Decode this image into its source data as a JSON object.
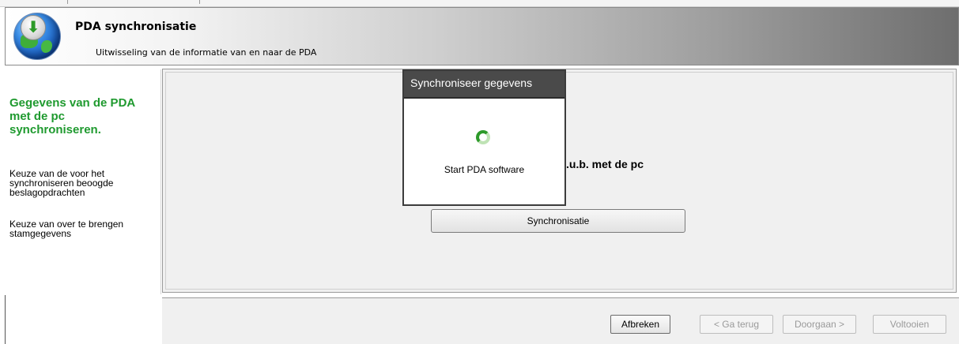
{
  "header": {
    "title": "PDA synchronisatie",
    "subtitle": "Uitwisseling van de informatie van en naar de PDA"
  },
  "sidebar": {
    "title": "Gegevens van de PDA\n met de pc\nsynchroniseren.",
    "items": [
      {
        "label": "Keuze van de voor het\nsynchroniseren beoogde\nbeslagopdrachten"
      },
      {
        "label": "Keuze van over te brengen\nstamgegevens"
      }
    ]
  },
  "main": {
    "instruction_partial": ".u.b. met de pc",
    "sync_button_label": "Synchronisatie"
  },
  "dialog": {
    "title": "Synchroniseer gegevens",
    "status_text": "Start PDA software"
  },
  "footer": {
    "buttons": [
      {
        "label": "Afbreken",
        "enabled": true
      },
      {
        "label": "< Ga terug",
        "enabled": false
      },
      {
        "label": "Doorgaan >",
        "enabled": false
      },
      {
        "label": "Voltooien",
        "enabled": false
      }
    ]
  },
  "colors": {
    "sidebar_title": "#1f9a2f",
    "dialog_title_bg": "#4a4a4a",
    "spinner": "#2d9a2a"
  }
}
